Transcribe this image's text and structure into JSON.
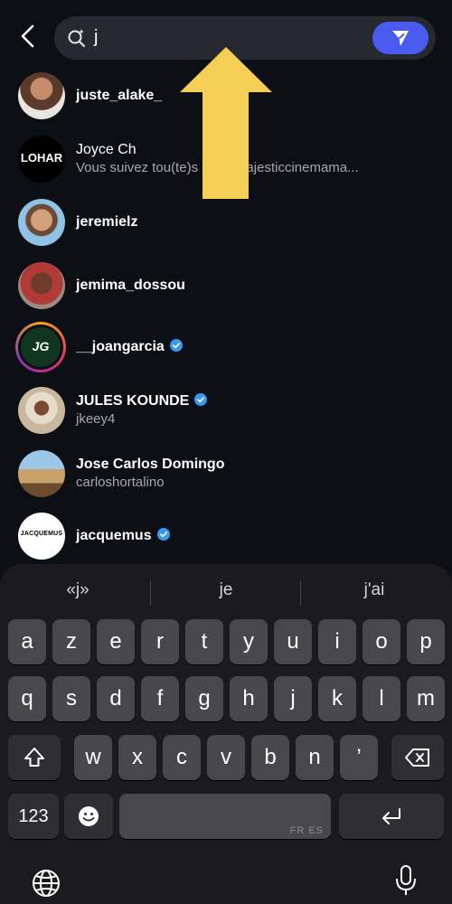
{
  "header": {
    "back_icon": "chevron-left-icon",
    "search_icon": "search-ai-icon",
    "search_query": "j",
    "send_icon": "paper-plane-icon",
    "send_button_color": "#4a5cf0"
  },
  "results": [
    {
      "username": "juste_alake_",
      "subtext": "",
      "verified": false
    },
    {
      "username": "Joyce Ch",
      "subtext": "Vous suivez tou(te)s deux majesticcinemama...",
      "verified": false
    },
    {
      "username": "jeremielz",
      "subtext": "",
      "verified": false
    },
    {
      "username": "jemima_dossou",
      "subtext": "",
      "verified": false
    },
    {
      "username": "__joangarcia",
      "subtext": "",
      "verified": true
    },
    {
      "username": "JULES KOUNDE",
      "subtext": "jkeey4",
      "verified": true
    },
    {
      "username": "Jose Carlos Domingo",
      "subtext": "carloshortalino",
      "verified": false
    },
    {
      "username": "jacquemus",
      "subtext": "",
      "verified": true
    }
  ],
  "avatar_texts": {
    "joyce": "LOHAR",
    "joangarcia": "JG",
    "jacquemus": "JACQUEMUS"
  },
  "annotation": {
    "arrow_color": "#f5cf55"
  },
  "keyboard": {
    "suggestions": [
      "«j»",
      "je",
      "j'ai"
    ],
    "row1": [
      "a",
      "z",
      "e",
      "r",
      "t",
      "y",
      "u",
      "i",
      "o",
      "p"
    ],
    "row2": [
      "q",
      "s",
      "d",
      "f",
      "g",
      "h",
      "j",
      "k",
      "l",
      "m"
    ],
    "row3": [
      "w",
      "x",
      "c",
      "v",
      "b",
      "n",
      "’"
    ],
    "numbers_label": "123",
    "space_label": "FR ES",
    "shift_icon": "shift-icon",
    "backspace_icon": "backspace-icon",
    "emoji_icon": "emoji-icon",
    "return_icon": "return-icon",
    "globe_icon": "globe-icon",
    "mic_icon": "microphone-icon"
  }
}
